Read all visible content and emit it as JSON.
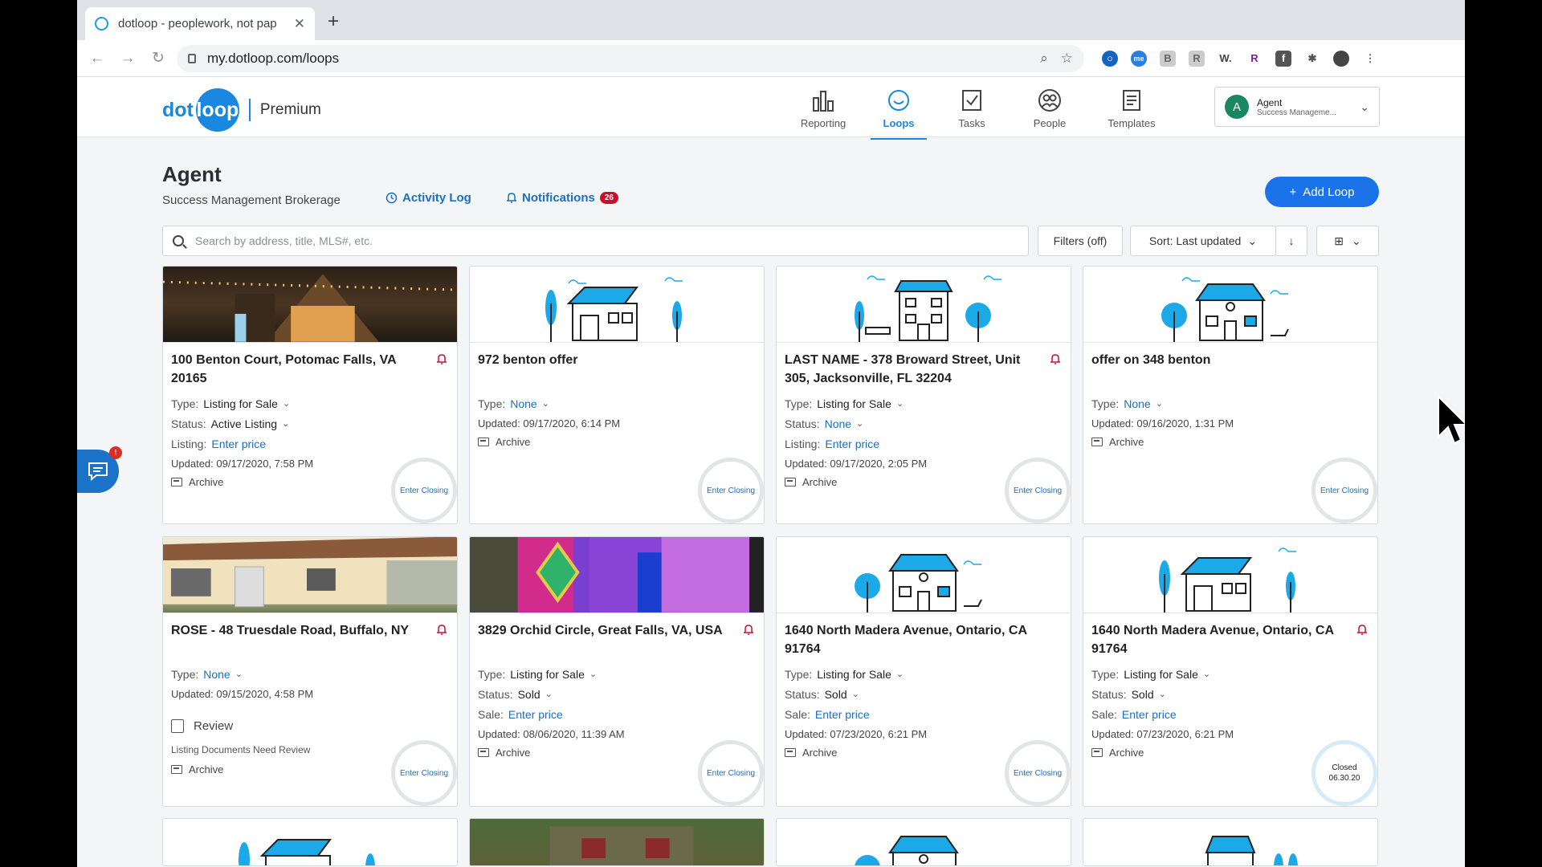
{
  "browser": {
    "tab_title": "dotloop - peoplework, not pap",
    "url": "my.dotloop.com/loops"
  },
  "header": {
    "logo_dot": "dot",
    "logo_loop": "loop",
    "plan": "Premium",
    "nav": [
      {
        "label": "Reporting",
        "icon": "bar-chart-icon"
      },
      {
        "label": "Loops",
        "icon": "loop-icon"
      },
      {
        "label": "Tasks",
        "icon": "checkbox-icon"
      },
      {
        "label": "People",
        "icon": "people-icon"
      },
      {
        "label": "Templates",
        "icon": "template-icon"
      }
    ],
    "account": {
      "initial": "A",
      "name": "Agent",
      "org": "Success Manageme..."
    }
  },
  "page": {
    "title": "Agent",
    "brokerage": "Success Management Brokerage",
    "activity_log": "Activity Log",
    "notifications": "Notifications",
    "notifications_count": "26",
    "add_loop": "Add Loop",
    "search_placeholder": "Search by address, title, MLS#, etc.",
    "filters": "Filters (off)",
    "sort": "Sort: Last updated"
  },
  "chat_badge": "!",
  "cards": [
    {
      "title": "100 Benton Court, Potomac Falls, VA 20165",
      "type": "Listing for Sale",
      "status": "Active Listing",
      "price_label": "Listing:",
      "price": "Enter price",
      "updated": "Updated: 09/17/2020, 7:58 PM",
      "archive": "Archive",
      "closing": "Enter Closing"
    },
    {
      "title": "972 benton offer",
      "type": "None",
      "updated": "Updated: 09/17/2020, 6:14 PM",
      "archive": "Archive",
      "closing": "Enter Closing"
    },
    {
      "title": "LAST NAME - 378 Broward Street, Unit 305, Jacksonville, FL 32204",
      "type": "Listing for Sale",
      "status": "None",
      "price_label": "Listing:",
      "price": "Enter price",
      "updated": "Updated: 09/17/2020, 2:05 PM",
      "archive": "Archive",
      "closing": "Enter Closing"
    },
    {
      "title": "offer on 348 benton",
      "type": "None",
      "updated": "Updated: 09/16/2020, 1:31 PM",
      "archive": "Archive",
      "closing": "Enter Closing"
    },
    {
      "title": "ROSE - 48 Truesdale Road, Buffalo, NY",
      "type": "None",
      "updated": "Updated: 09/15/2020, 4:58 PM",
      "review": "Review",
      "review_note": "Listing Documents Need Review",
      "archive": "Archive",
      "closing": "Enter Closing"
    },
    {
      "title": "3829 Orchid Circle, Great Falls, VA, USA",
      "type": "Listing for Sale",
      "status": "Sold",
      "price_label": "Sale:",
      "price": "Enter price",
      "updated": "Updated: 08/06/2020, 11:39 AM",
      "archive": "Archive",
      "closing": "Enter Closing"
    },
    {
      "title": "1640 North Madera Avenue, Ontario, CA 91764",
      "type": "Listing for Sale",
      "status": "Sold",
      "price_label": "Sale:",
      "price": "Enter price",
      "updated": "Updated: 07/23/2020, 6:21 PM",
      "archive": "Archive",
      "closing": "Enter Closing"
    },
    {
      "title": "1640 North Madera Avenue, Ontario, CA 91764",
      "type": "Listing for Sale",
      "status": "Sold",
      "price_label": "Sale:",
      "price": "Enter price",
      "updated": "Updated: 07/23/2020, 6:21 PM",
      "archive": "Archive",
      "closing": "Closed 06.30.20"
    }
  ],
  "labels": {
    "type": "Type:",
    "status": "Status:"
  },
  "colors": {
    "brand": "#1a87e0",
    "accent": "#1ba9e8",
    "badge": "#c8102e"
  }
}
